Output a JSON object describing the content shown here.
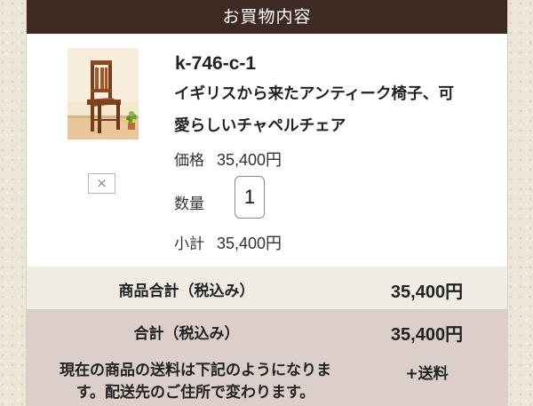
{
  "header": {
    "title": "お買物内容"
  },
  "item": {
    "thumbnail_icon": "chair-photo",
    "remove_label": "×",
    "code": "k-746-c-1",
    "name_line1": "イギリスから来たアンティーク椅子、可",
    "name_line2": "愛らしいチャペルチェア",
    "price_label": "価格",
    "price_value": "35,400円",
    "quantity_label": "数量",
    "quantity_value": "1",
    "subtotal_label": "小計",
    "subtotal_value": "35,400円"
  },
  "totals": {
    "products_total_label": "商品合計（税込み）",
    "products_total_value": "35,400円",
    "grand_total_label": "合計（税込み）",
    "grand_total_value": "35,400円",
    "shipping_note_line1": "現在の商品の送料は下記のようになりま",
    "shipping_note_line2": "す。配送先のご住所で変わります。",
    "shipping_value": "+送料"
  },
  "colors": {
    "header_bg": "#3d2a22",
    "products_total_bg": "#f0ebe3",
    "grand_total_bg": "#dccfca",
    "page_bg": "#ece6d6"
  }
}
